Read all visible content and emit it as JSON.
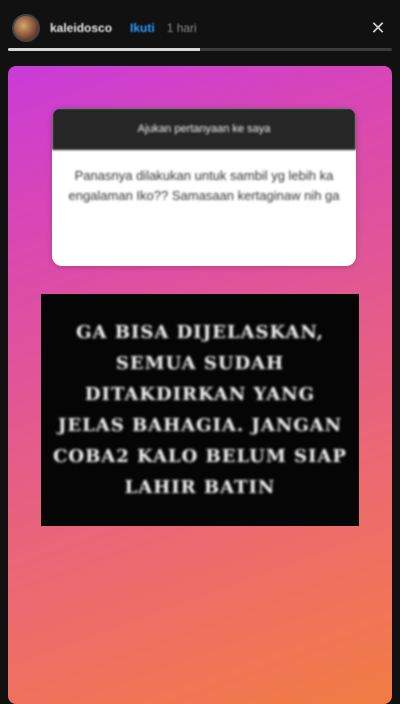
{
  "header": {
    "username": "kaleidosco",
    "follow_label": "Ikuti",
    "time": "1 hari",
    "close_icon": "close-icon",
    "progress": 0.5
  },
  "story": {
    "question": {
      "title": "Ajukan pertanyaan ke saya",
      "text": "Panasnya dilakukan untuk sambil yg lebih ka engalaman Iko?? Samasaan kertaginaw nih ga"
    },
    "answer": {
      "text": "GA BISA DIJELASKAN, SEMUA SUDAH DITAKDIRKAN YANG JELAS BAHAGIA. JANGAN COBA2 KALO BELUM SIAP LAHIR BATIN"
    },
    "background": {
      "gradient_start": "#c93bd9",
      "gradient_end": "#f27d43"
    }
  }
}
